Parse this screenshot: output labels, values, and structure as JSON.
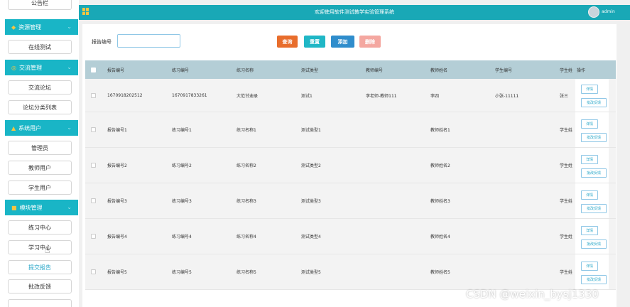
{
  "topbar": {
    "title": "欢迎使用软件测试教学实验管理系统",
    "user": "admin"
  },
  "sidebar": {
    "top_item": "公告栏",
    "sections": [
      {
        "label": "资源管理",
        "items": [
          "在线测试"
        ]
      },
      {
        "label": "交流管理",
        "items": [
          "交流论坛",
          "论坛分类列表"
        ]
      },
      {
        "label": "系统用户",
        "items": [
          "管理员",
          "教师用户",
          "学生用户"
        ]
      },
      {
        "label": "模块管理",
        "items": [
          "练习中心",
          "学习中心",
          "提交报告",
          "批改反馈"
        ]
      }
    ]
  },
  "search": {
    "label": "报告编号",
    "value": "",
    "placeholder": ""
  },
  "buttons": {
    "query": "查询",
    "reset": "重置",
    "add": "添加",
    "delete": "删除"
  },
  "table": {
    "headers": [
      "报告编号",
      "练习编号",
      "练习名称",
      "测试类型",
      "教师编号",
      "教师姓名",
      "学生编号",
      "学生姓",
      "操作"
    ],
    "rows": [
      [
        "1670918202512",
        "1670917833261",
        "大范甘迪录",
        "测试1",
        "李老师-教师111",
        "李四",
        "小张-11111",
        "张三"
      ],
      [
        "报告编号1",
        "练习编号1",
        "练习名称1",
        "测试类型1",
        "",
        "教师姓名1",
        "",
        "学生姓"
      ],
      [
        "报告编号2",
        "练习编号2",
        "练习名称2",
        "测试类型2",
        "",
        "教师姓名2",
        "",
        "学生姓"
      ],
      [
        "报告编号3",
        "练习编号3",
        "练习名称3",
        "测试类型3",
        "",
        "教师姓名3",
        "",
        "学生姓"
      ],
      [
        "报告编号4",
        "练习编号4",
        "练习名称4",
        "测试类型4",
        "",
        "教师姓名4",
        "",
        "学生姓"
      ],
      [
        "报告编号5",
        "练习编号5",
        "练习名称5",
        "测试类型5",
        "",
        "教师姓名5",
        "",
        "学生姓"
      ]
    ],
    "actions": {
      "detail": "详情",
      "review": "批改反馈"
    }
  },
  "watermark": "CSDN @weixin_bysj1330",
  "colors": {
    "accent": "#19b5c6",
    "topbar": "#19a8b6",
    "query": "#e86d2c",
    "reset": "#20b7c6",
    "add": "#2f8dcc",
    "delete": "#f4a7a0"
  }
}
